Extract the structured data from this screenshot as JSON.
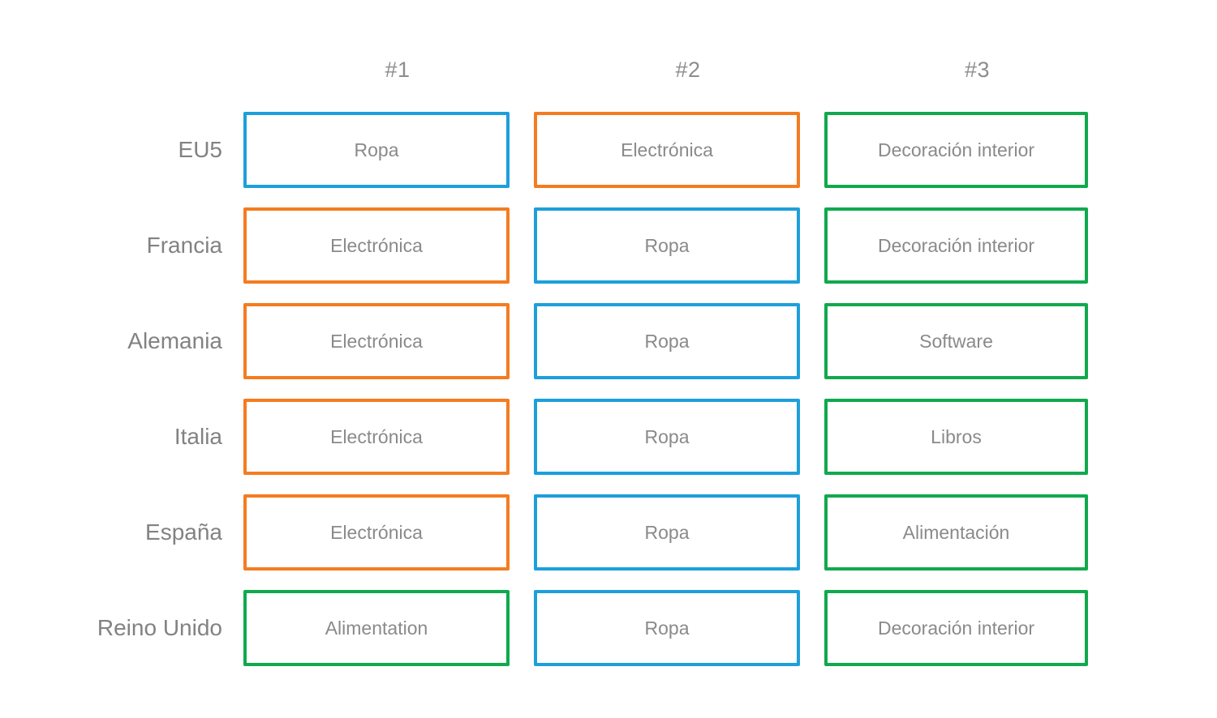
{
  "colors": {
    "blue": "#1d9fdb",
    "orange": "#f47c20",
    "green": "#10a94d",
    "text_gray": "#8a8a8a",
    "label_gray": "#828282",
    "header_gray": "#8d8d8d",
    "background": "#ffffff"
  },
  "headers": {
    "corner": "",
    "rank1": "#1",
    "rank2": "#2",
    "rank3": "#3"
  },
  "rows": [
    {
      "label": "EU5",
      "cells": [
        {
          "text": "Ropa",
          "color": "blue"
        },
        {
          "text": "Electrónica",
          "color": "orange"
        },
        {
          "text": "Decoración interior",
          "color": "green"
        }
      ]
    },
    {
      "label": "Francia",
      "cells": [
        {
          "text": "Electrónica",
          "color": "orange"
        },
        {
          "text": "Ropa",
          "color": "blue"
        },
        {
          "text": "Decoración interior",
          "color": "green"
        }
      ]
    },
    {
      "label": "Alemania",
      "cells": [
        {
          "text": "Electrónica",
          "color": "orange"
        },
        {
          "text": "Ropa",
          "color": "blue"
        },
        {
          "text": "Software",
          "color": "green"
        }
      ]
    },
    {
      "label": "Italia",
      "cells": [
        {
          "text": "Electrónica",
          "color": "orange"
        },
        {
          "text": "Ropa",
          "color": "blue"
        },
        {
          "text": "Libros",
          "color": "green"
        }
      ]
    },
    {
      "label": "España",
      "cells": [
        {
          "text": "Electrónica",
          "color": "orange"
        },
        {
          "text": "Ropa",
          "color": "blue"
        },
        {
          "text": "Alimentación",
          "color": "green"
        }
      ]
    },
    {
      "label": "Reino Unido",
      "cells": [
        {
          "text": "Alimentation",
          "color": "green"
        },
        {
          "text": "Ropa",
          "color": "blue"
        },
        {
          "text": "Decoración interior",
          "color": "green"
        }
      ]
    }
  ]
}
